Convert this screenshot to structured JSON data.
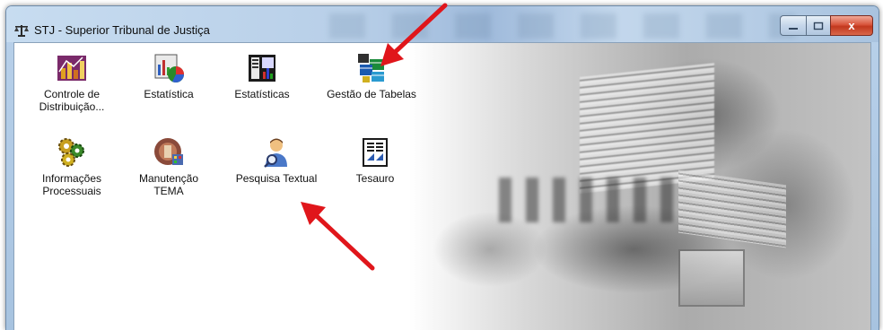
{
  "window": {
    "title": "STJ - Superior Tribunal de Justiça",
    "app_icon": "scales-of-justice-icon",
    "controls": {
      "minimize": "minimize-icon",
      "maximize": "maximize-icon",
      "close": "close-icon",
      "close_glyph": "x"
    }
  },
  "desktop": {
    "items": [
      {
        "id": "controle-distribuicao",
        "label_line1": "Controle de",
        "label_line2": "Distribuição...",
        "icon": "bar-chart-icon"
      },
      {
        "id": "estatistica",
        "label_line1": "Estatística",
        "label_line2": "",
        "icon": "pie-chart-icon"
      },
      {
        "id": "estatisticas",
        "label_line1": "Estatísticas",
        "label_line2": "",
        "icon": "statistics-report-icon"
      },
      {
        "id": "gestao-tabelas",
        "label_line1": "Gestão de Tabelas",
        "label_line2": "",
        "icon": "tables-icon"
      },
      {
        "id": "informacoes-processuais",
        "label_line1": "Informações",
        "label_line2": "Processuais",
        "icon": "gears-icon"
      },
      {
        "id": "manutencao-tema",
        "label_line1": "Manutenção",
        "label_line2": "TEMA",
        "icon": "maintenance-icon"
      },
      {
        "id": "pesquisa-textual",
        "label_line1": "Pesquisa Textual",
        "label_line2": "",
        "icon": "person-search-icon"
      },
      {
        "id": "tesauro",
        "label_line1": "Tesauro",
        "label_line2": "",
        "icon": "document-icon"
      }
    ]
  },
  "annotations": {
    "arrow_color": "#e0161b",
    "arrows": [
      {
        "points_to": "gestao-tabelas"
      },
      {
        "points_to": "pesquisa-textual"
      }
    ]
  },
  "colors": {
    "titlebar": "#b9d1ea",
    "close_button": "#c2381e"
  }
}
